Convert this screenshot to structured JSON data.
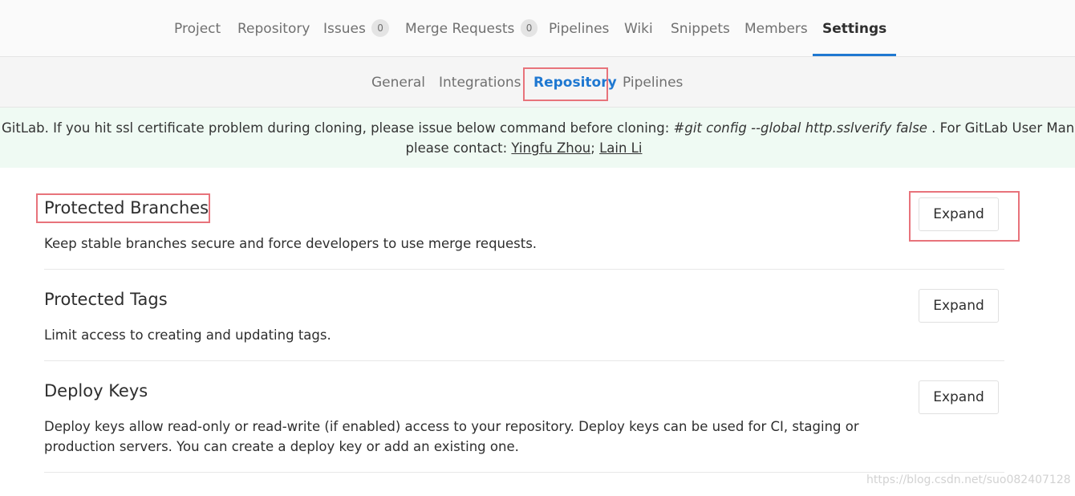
{
  "topnav": {
    "items": [
      {
        "label": "Project"
      },
      {
        "label": "Repository"
      },
      {
        "label": "Issues",
        "count": "0"
      },
      {
        "label": "Merge Requests",
        "count": "0"
      },
      {
        "label": "Pipelines"
      },
      {
        "label": "Wiki"
      },
      {
        "label": "Snippets"
      },
      {
        "label": "Members"
      },
      {
        "label": "Settings",
        "active": true
      }
    ]
  },
  "subnav": {
    "items": [
      {
        "label": "General"
      },
      {
        "label": "Integrations"
      },
      {
        "label": "Repository",
        "active": true
      },
      {
        "label": "Pipelines"
      }
    ]
  },
  "banner": {
    "line1_prefix": "GitLab. If you hit ssl certificate problem during cloning, please issue below command before cloning: ",
    "line1_command": "#git config --global http.sslverify false",
    "line1_suffix": " . For GitLab User Manual, please loo",
    "line2_prefix": "please contact: ",
    "contact1": "Yingfu Zhou",
    "separator": "; ",
    "contact2": "Lain Li"
  },
  "sections": [
    {
      "title": "Protected Branches",
      "description": "Keep stable branches secure and force developers to use merge requests.",
      "button": "Expand"
    },
    {
      "title": "Protected Tags",
      "description": "Limit access to creating and updating tags.",
      "button": "Expand"
    },
    {
      "title": "Deploy Keys",
      "description": "Deploy keys allow read-only or read-write (if enabled) access to your repository. Deploy keys can be used for CI, staging or production servers. You can create a deploy key or add an existing one.",
      "button": "Expand"
    }
  ],
  "watermark": "https://blog.csdn.net/suo082407128",
  "colors": {
    "accent": "#1f78d1",
    "highlight_box": "#e8737b",
    "banner_bg": "#effaf3"
  }
}
